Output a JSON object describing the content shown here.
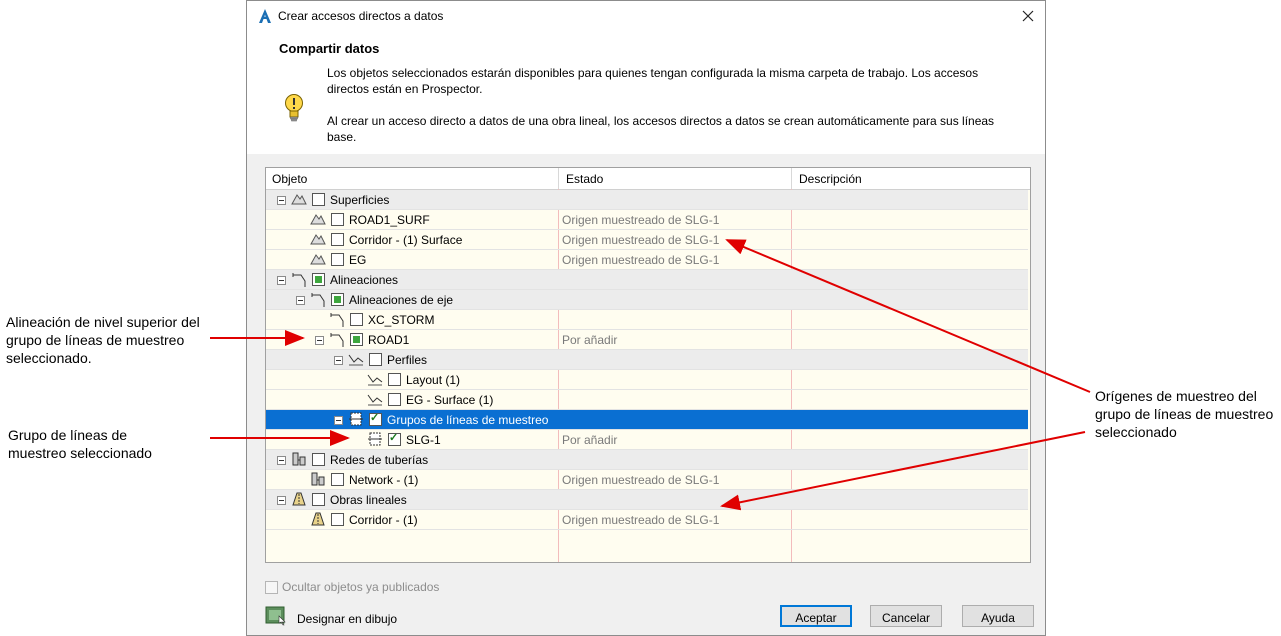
{
  "dialog": {
    "title": "Crear accesos directos a datos",
    "header_title": "Compartir datos",
    "paragraph1": "Los objetos seleccionados estarán disponibles para quienes tengan configurada la misma carpeta de trabajo. Los accesos directos están en Prospector.",
    "paragraph2": "Al crear un acceso directo a datos de una obra lineal, los accesos directos a datos se crean automáticamente para sus líneas base."
  },
  "grid": {
    "columns": [
      "Objeto",
      "Estado",
      "Descripción"
    ],
    "rows": [
      {
        "label": "Superficies",
        "state": ""
      },
      {
        "label": "ROAD1_SURF",
        "state": "Origen muestreado de SLG-1"
      },
      {
        "label": "Corridor - (1) Surface",
        "state": "Origen muestreado de SLG-1"
      },
      {
        "label": "EG",
        "state": "Origen muestreado de SLG-1"
      },
      {
        "label": "Alineaciones",
        "state": ""
      },
      {
        "label": "Alineaciones de eje",
        "state": ""
      },
      {
        "label": "XC_STORM",
        "state": ""
      },
      {
        "label": "ROAD1",
        "state": "Por añadir"
      },
      {
        "label": "Perfiles",
        "state": ""
      },
      {
        "label": "Layout (1)",
        "state": ""
      },
      {
        "label": "EG - Surface (1)",
        "state": ""
      },
      {
        "label": "Grupos de líneas de muestreo",
        "state": ""
      },
      {
        "label": "SLG-1",
        "state": "Por añadir"
      },
      {
        "label": "Redes de tuberías",
        "state": ""
      },
      {
        "label": "Network - (1)",
        "state": "Origen muestreado de SLG-1"
      },
      {
        "label": "Obras lineales",
        "state": ""
      },
      {
        "label": "Corridor - (1)",
        "state": "Origen muestreado de SLG-1"
      }
    ]
  },
  "footer": {
    "hide_published_label": "Ocultar objetos ya publicados",
    "hide_published_checked": false,
    "pick_in_drawing_label": "Designar en dibujo",
    "ok_label": "Aceptar",
    "cancel_label": "Cancelar",
    "help_label": "Ayuda"
  },
  "annotations": {
    "top_alignment": "Alineación de nivel superior del grupo de líneas de muestreo seleccionado.",
    "sample_group": "Grupo de líneas de muestreo seleccionado",
    "sources": "Orígenes de muestreo del grupo de líneas de muestreo seleccionado"
  },
  "colors": {
    "selection": "#0a6fd2",
    "arrow": "#e00000",
    "grid_background": "#fffdf0",
    "check_green": "#3ea63e"
  }
}
